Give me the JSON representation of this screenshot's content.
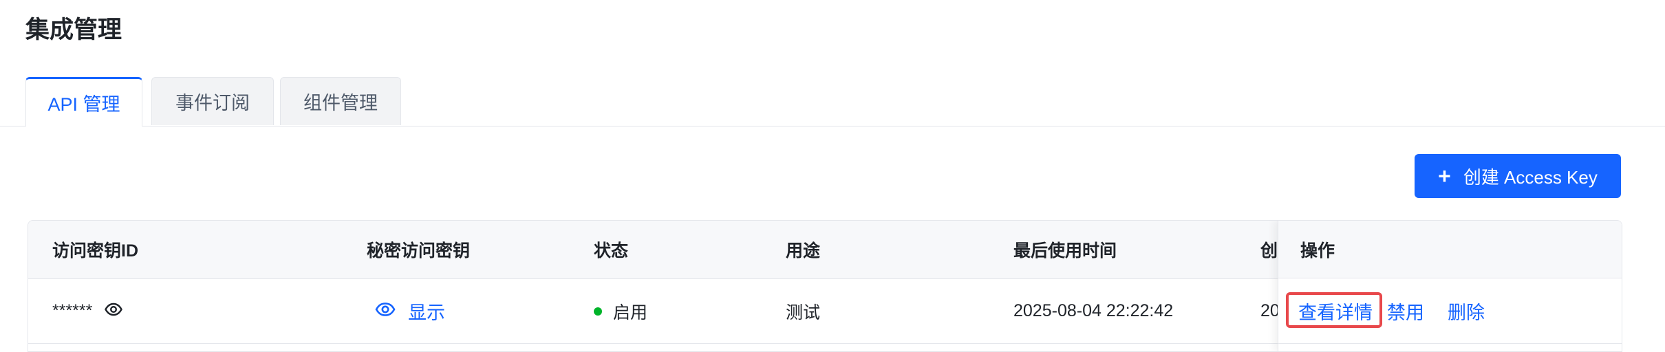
{
  "page": {
    "title": "集成管理"
  },
  "tabs": [
    {
      "label": "API 管理",
      "active": true
    },
    {
      "label": "事件订阅",
      "active": false
    },
    {
      "label": "组件管理",
      "active": false
    }
  ],
  "toolbar": {
    "create_label": "创建 Access Key",
    "create_icon": "plus-icon"
  },
  "table": {
    "columns": [
      "访问密钥ID",
      "秘密访问密钥",
      "状态",
      "用途",
      "最后使用时间",
      "创",
      "操作"
    ],
    "rows": [
      {
        "key_id": "******",
        "secret_action": "显示",
        "status": "启用",
        "status_color": "#00b42a",
        "purpose": "测试",
        "last_used": "2025-08-04 22:22:42",
        "created_partial": "20",
        "actions": {
          "detail": "查看详情",
          "disable": "禁用",
          "delete": "删除"
        }
      }
    ]
  },
  "colors": {
    "accent": "#1664ff",
    "highlight": "#e8484b"
  }
}
